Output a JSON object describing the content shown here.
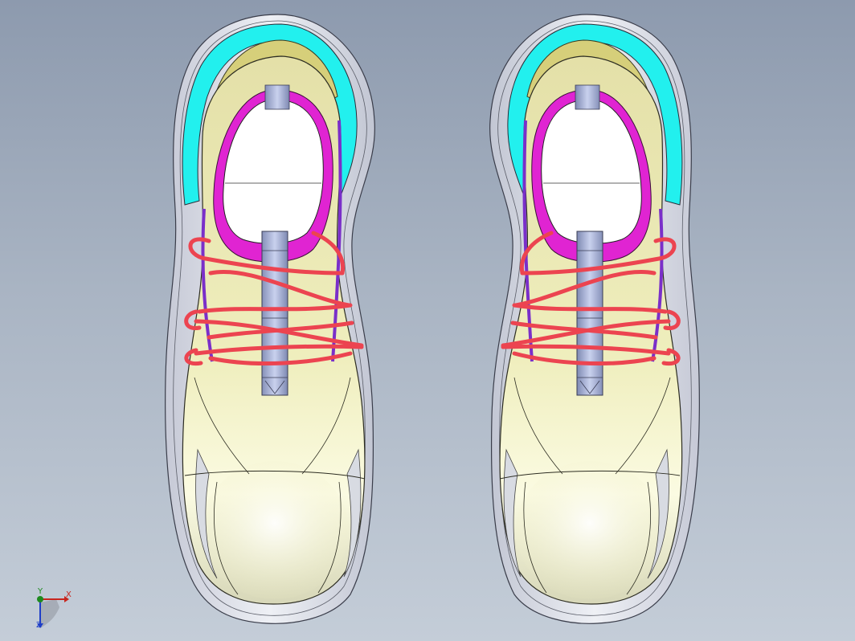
{
  "viewport": {
    "background_top": "#8d9aae",
    "background_bottom": "#c4cdd8"
  },
  "model": {
    "parts": [
      {
        "name": "left-shoe"
      },
      {
        "name": "right-shoe"
      }
    ],
    "colors": {
      "upper": "#ecebbf",
      "sole": "#d8dbe6",
      "collar": "#22f0ee",
      "lining": "#e024d2",
      "laces": "#ec4450",
      "eyelet_trim": "#7a2fc9",
      "tongue_tab": "#a4b0d6",
      "opening": "#ffffff"
    }
  },
  "triad": {
    "x_label": "X",
    "y_label": "Y",
    "z_label": "Z",
    "icon": "coordinate-axes-icon",
    "colors": {
      "x": "#c8261e",
      "y": "#1e8a1e",
      "z": "#1e3ec8"
    }
  }
}
